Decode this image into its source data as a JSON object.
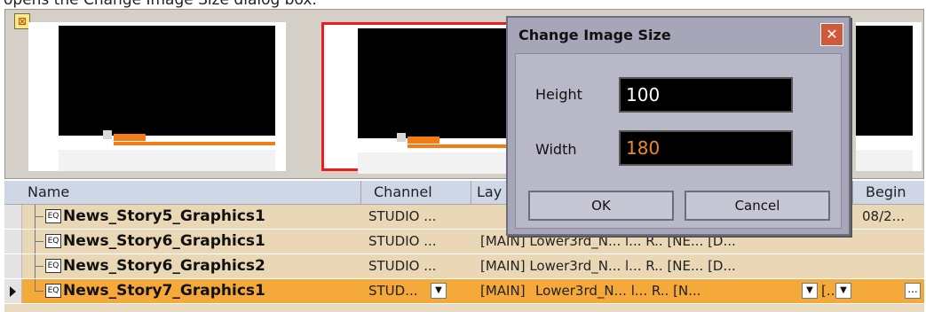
{
  "caption": "opens the Change Image Size dialog box.",
  "dialog": {
    "title": "Change Image Size",
    "height_label": "Height",
    "height_value": "100",
    "width_label": "Width",
    "width_value": "180",
    "ok_label": "OK",
    "cancel_label": "Cancel",
    "close_glyph": "✕"
  },
  "thumbnail_strip": {
    "icon_glyph": "⊠"
  },
  "grid": {
    "columns": [
      "Name",
      "Channel",
      "Lay",
      "Begin"
    ],
    "rows": [
      {
        "name": "News_Story5_Graphics1",
        "channel": "STUDIO ...",
        "layout": "",
        "begin": "08/2..."
      },
      {
        "name": "News_Story6_Graphics1",
        "channel": "STUDIO ...",
        "layout": "[MAIN]  Lower3rd_N... l... R.. [NE...  [D...",
        "begin": ""
      },
      {
        "name": "News_Story6_Graphics2",
        "channel": "STUDIO ...",
        "layout": "[MAIN]  Lower3rd_N... l... R.. [NE...  [D...",
        "begin": ""
      },
      {
        "name": "News_Story7_Graphics1",
        "channel": "STUD...",
        "layout_main": "[MAIN]",
        "layout_rest": "Lower3rd_N... l... R.. [N...",
        "layout_tail": "[..",
        "begin": ""
      }
    ],
    "item_icon_glyph": "EQ",
    "dropdown_glyph": "▼",
    "ellipsis_glyph": "..."
  },
  "colors": {
    "selected_border": "#ee1c1c",
    "current_row": "#f6a93b",
    "row_bg": "#ead7b6",
    "height_text": "#ffffff",
    "width_text": "#f08a24"
  }
}
